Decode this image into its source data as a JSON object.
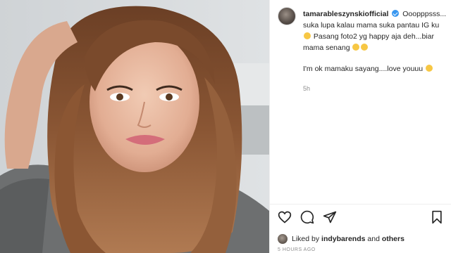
{
  "post": {
    "username": "tamarableszynskiofficial",
    "caption_line1": "Ooopppsss... suka lupa kalau mama suka pantau IG ku",
    "caption_line2": "Pasang foto2 yg happy aja deh...biar mama senang",
    "reply": "I'm ok mamaku sayang....love youuu",
    "time_ago": "5h"
  },
  "likes": {
    "prefix": "Liked by",
    "user": "indybarends",
    "joiner": "and",
    "others": "others"
  },
  "timestamp": "5 HOURS AGO",
  "icons": {
    "like": "heart-icon",
    "comment": "comment-icon",
    "share": "send-icon",
    "save": "bookmark-icon",
    "verified": "verified-badge-icon"
  },
  "colors": {
    "verified": "#3897f0",
    "muted": "#8e8e8e",
    "text": "#262626"
  }
}
